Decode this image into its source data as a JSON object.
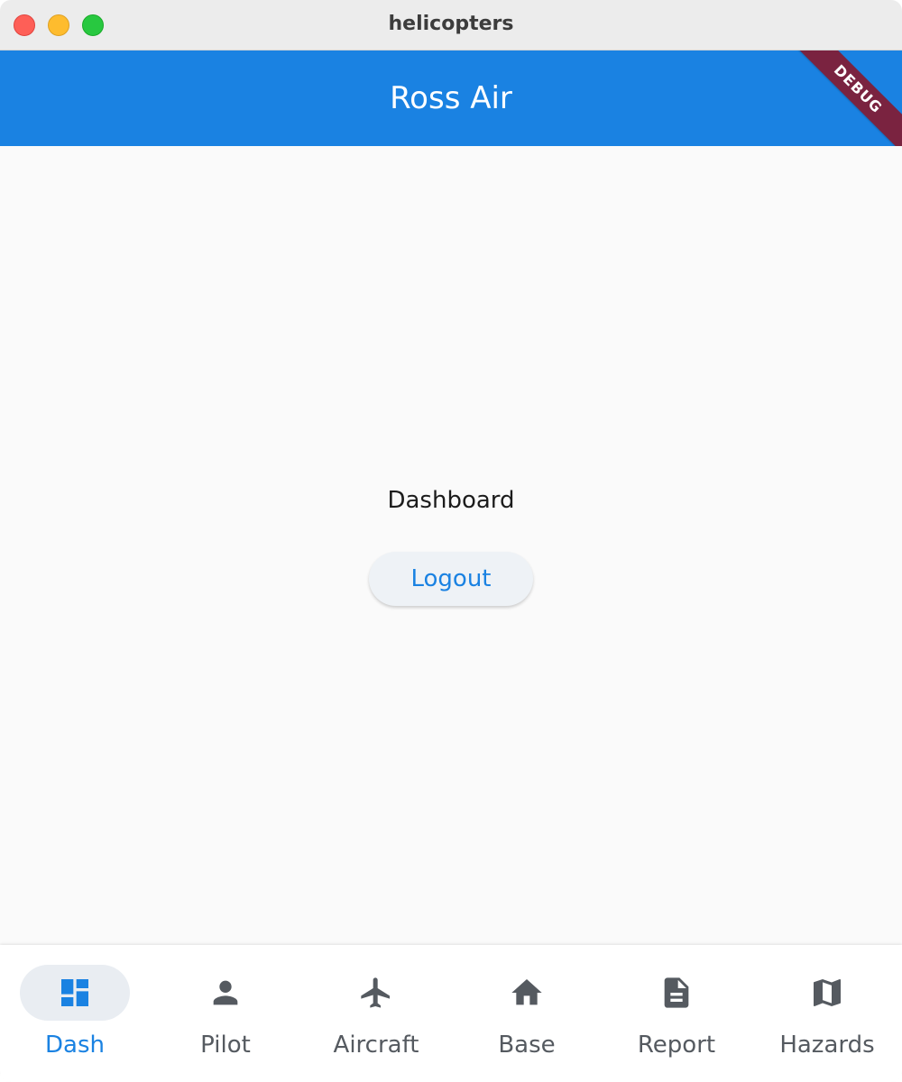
{
  "window": {
    "title": "helicopters"
  },
  "appbar": {
    "title": "Ross Air",
    "debug_banner": "DEBUG",
    "color": "#1a82e2"
  },
  "main": {
    "heading": "Dashboard",
    "logout_label": "Logout"
  },
  "bottom_nav": {
    "items": [
      {
        "label": "Dash",
        "icon": "dashboard-icon",
        "active": true
      },
      {
        "label": "Pilot",
        "icon": "person-icon",
        "active": false
      },
      {
        "label": "Aircraft",
        "icon": "airplane-icon",
        "active": false
      },
      {
        "label": "Base",
        "icon": "home-icon",
        "active": false
      },
      {
        "label": "Report",
        "icon": "document-icon",
        "active": false
      },
      {
        "label": "Hazards",
        "icon": "map-icon",
        "active": false
      }
    ],
    "active_color": "#1a82e2",
    "inactive_color": "#555a60"
  }
}
